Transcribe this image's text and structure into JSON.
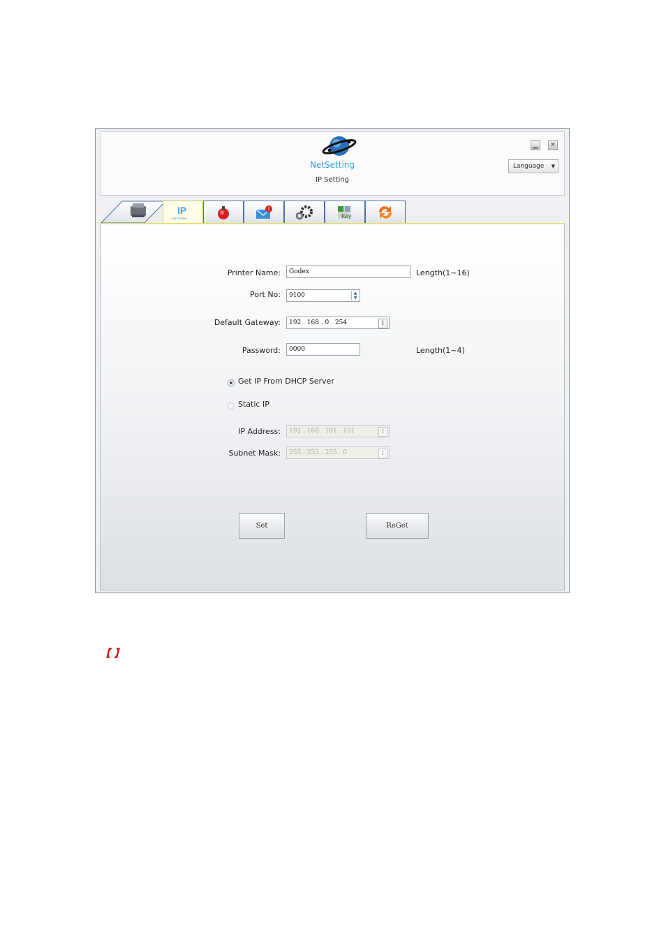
{
  "window": {
    "brand": "NetSetting",
    "subtitle": "IP Setting",
    "language_label": "Language"
  },
  "tabs": [
    {
      "name": "printer",
      "icon": "printer-icon"
    },
    {
      "name": "ip-network",
      "icon": "ip-network-icon",
      "label": "NETWORK",
      "active": true
    },
    {
      "name": "alert",
      "icon": "alarm-icon"
    },
    {
      "name": "email",
      "icon": "email-alert-icon"
    },
    {
      "name": "settings",
      "icon": "gear-icon"
    },
    {
      "name": "key",
      "icon": "key-icon"
    },
    {
      "name": "refresh",
      "icon": "refresh-icon"
    }
  ],
  "form": {
    "printer_name_label": "Printer Name:",
    "printer_name_value": "Godex",
    "printer_name_hint": "Length(1~16)",
    "port_label": "Port No:",
    "port_value": "9100",
    "gateway_label": "Default Gateway:",
    "gateway_value": "192 . 168 . 0 . 254",
    "password_label": "Password:",
    "password_value": "0000",
    "password_hint": "Length(1~4)",
    "dhcp_label": "Get IP From DHCP Server",
    "static_label": "Static IP",
    "dhcp_selected": true,
    "ip_label": "IP Address:",
    "ip_value": "192 . 168 . 101 . 151",
    "mask_label": "Subnet Mask:",
    "mask_value": "255 . 255 . 255 . 0"
  },
  "buttons": {
    "set": "Set",
    "reget": "ReGet"
  },
  "note": "【  】",
  "colors": {
    "brand": "#3aa0d6",
    "active_tab": "#fffde8",
    "note": "#e01010"
  }
}
